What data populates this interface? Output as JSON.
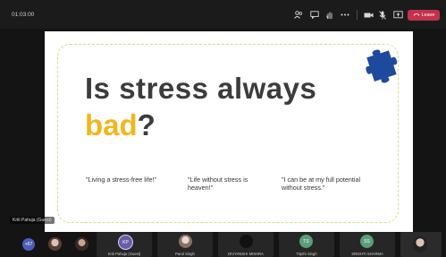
{
  "meeting": {
    "timer": "01:03:00",
    "leave_label": "Leave"
  },
  "slide": {
    "title_line1": "Is stress always",
    "title_highlight": "bad",
    "title_suffix": "?",
    "quotes": [
      "\"Living a stress-free life!\"",
      "\"Life without stress is heaven!\"",
      "\"I can be at my full potential without stress.\""
    ],
    "colors": {
      "highlight": "#f2b51d",
      "puzzle": "#1e4a9e",
      "frame": "#cfe08a"
    }
  },
  "presenter_label": "Kriti Pahuja (Guest)",
  "participants": {
    "overflow_count": "+67",
    "tiles": [
      {
        "initials": "KP",
        "name": "Kriti Pahuja (Guest)",
        "avatar_color": "#6b5ca5"
      },
      {
        "initials": "",
        "name": "Parul Singh",
        "avatar_color": "#777"
      },
      {
        "initials": "",
        "name": "DIVYANSHI MISHRA",
        "avatar_color": "#222"
      },
      {
        "initials": "TS",
        "name": "Tripthi Singh",
        "avatar_color": "#5a9e7a"
      },
      {
        "initials": "SS",
        "name": "SRISHTI SHARMA",
        "avatar_color": "#5a9e7a"
      }
    ]
  }
}
